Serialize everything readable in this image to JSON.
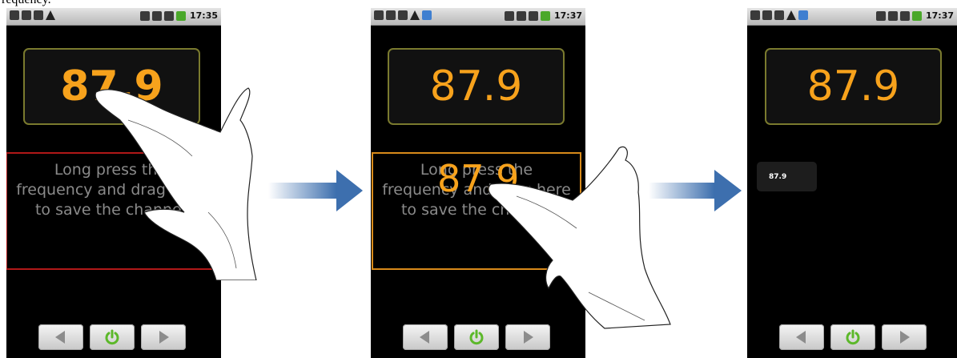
{
  "caption": "requency.",
  "panels": [
    {
      "time": "17:35",
      "frequency": "87.9",
      "drop_text": [
        "Long press the",
        "frequency and drag here",
        "to save the channel"
      ]
    },
    {
      "time": "17:37",
      "frequency": "87.9",
      "dragging_frequency": "87.9",
      "drop_text": [
        "Long press the",
        "frequency and drag here",
        "to save the channel"
      ]
    },
    {
      "time": "17:37",
      "frequency": "87.9",
      "saved_channel": "87.9"
    }
  ],
  "colors": {
    "frequency": "#f7a21c",
    "drop_zone_idle": "#b01818",
    "drop_zone_active": "#d88a1a",
    "arrow": "#3d6fae",
    "power_icon": "#5cb82a"
  },
  "icons": [
    "prev-icon",
    "power-icon",
    "next-icon",
    "arrow-right-icon",
    "hand-illustration"
  ]
}
